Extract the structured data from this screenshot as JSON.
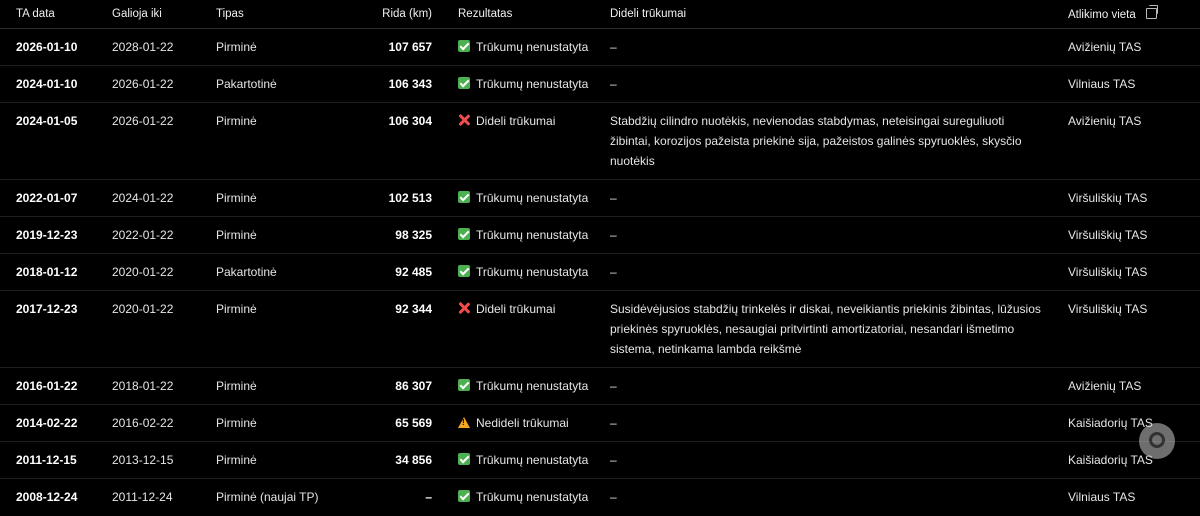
{
  "table": {
    "headers": {
      "date": "TA data",
      "valid": "Galioja iki",
      "type": "Tipas",
      "mileage": "Rida (km)",
      "result": "Rezultatas",
      "defects": "Dideli trūkumai",
      "place": "Atlikimo vieta"
    },
    "rows": [
      {
        "date": "2026-01-10",
        "valid": "2028-01-22",
        "type": "Pirminė",
        "mileage": "107 657",
        "result": "Trūkumų nenustatyta",
        "result_icon": "check-icon",
        "defects": "–",
        "place": "Avižienių TAS"
      },
      {
        "date": "2024-01-10",
        "valid": "2026-01-22",
        "type": "Pakartotinė",
        "mileage": "106 343",
        "result": "Trūkumų nenustatyta",
        "result_icon": "check-icon",
        "defects": "–",
        "place": "Vilniaus TAS"
      },
      {
        "date": "2024-01-05",
        "valid": "2026-01-22",
        "type": "Pirminė",
        "mileage": "106 304",
        "result": "Dideli trūkumai",
        "result_icon": "cross-icon",
        "defects": "Stabdžių cilindro nuotėkis, nevienodas stabdymas, neteisingai sureguliuoti žibintai, korozijos pažeista priekinė sija, pažeistos galinės spyruoklės, skysčio nuotėkis",
        "place": "Avižienių TAS"
      },
      {
        "date": "2022-01-07",
        "valid": "2024-01-22",
        "type": "Pirminė",
        "mileage": "102 513",
        "result": "Trūkumų nenustatyta",
        "result_icon": "check-icon",
        "defects": "–",
        "place": "Viršuliškių TAS"
      },
      {
        "date": "2019-12-23",
        "valid": "2022-01-22",
        "type": "Pirminė",
        "mileage": "98 325",
        "result": "Trūkumų nenustatyta",
        "result_icon": "check-icon",
        "defects": "–",
        "place": "Viršuliškių TAS"
      },
      {
        "date": "2018-01-12",
        "valid": "2020-01-22",
        "type": "Pakartotinė",
        "mileage": "92 485",
        "result": "Trūkumų nenustatyta",
        "result_icon": "check-icon",
        "defects": "–",
        "place": "Viršuliškių TAS"
      },
      {
        "date": "2017-12-23",
        "valid": "2020-01-22",
        "type": "Pirminė",
        "mileage": "92 344",
        "result": "Dideli trūkumai",
        "result_icon": "cross-icon",
        "defects": "Susidėvėjusios stabdžių trinkelės ir diskai, neveikiantis priekinis žibintas, lūžusios priekinės spyruoklės, nesaugiai pritvirtinti amortizatoriai, nesandari išmetimo sistema, netinkama lambda reikšmė",
        "place": "Viršuliškių TAS"
      },
      {
        "date": "2016-01-22",
        "valid": "2018-01-22",
        "type": "Pirminė",
        "mileage": "86 307",
        "result": "Trūkumų nenustatyta",
        "result_icon": "check-icon",
        "defects": "–",
        "place": "Avižienių TAS"
      },
      {
        "date": "2014-02-22",
        "valid": "2016-02-22",
        "type": "Pirminė",
        "mileage": "65 569",
        "result": "Nedideli trūkumai",
        "result_icon": "warning-icon",
        "defects": "–",
        "place": "Kaišiadorių TAS"
      },
      {
        "date": "2011-12-15",
        "valid": "2013-12-15",
        "type": "Pirminė",
        "mileage": "34 856",
        "result": "Trūkumų nenustatyta",
        "result_icon": "check-icon",
        "defects": "–",
        "place": "Kaišiadorių TAS"
      },
      {
        "date": "2008-12-24",
        "valid": "2011-12-24",
        "type": "Pirminė (naujai TP)",
        "mileage": "–",
        "result": "Trūkumų nenustatyta",
        "result_icon": "check-icon",
        "defects": "–",
        "place": "Vilniaus TAS"
      }
    ]
  },
  "colors": {
    "background": "#000000",
    "ok": "#4caf50",
    "error": "#f24d4d",
    "warning": "#f5a623"
  }
}
